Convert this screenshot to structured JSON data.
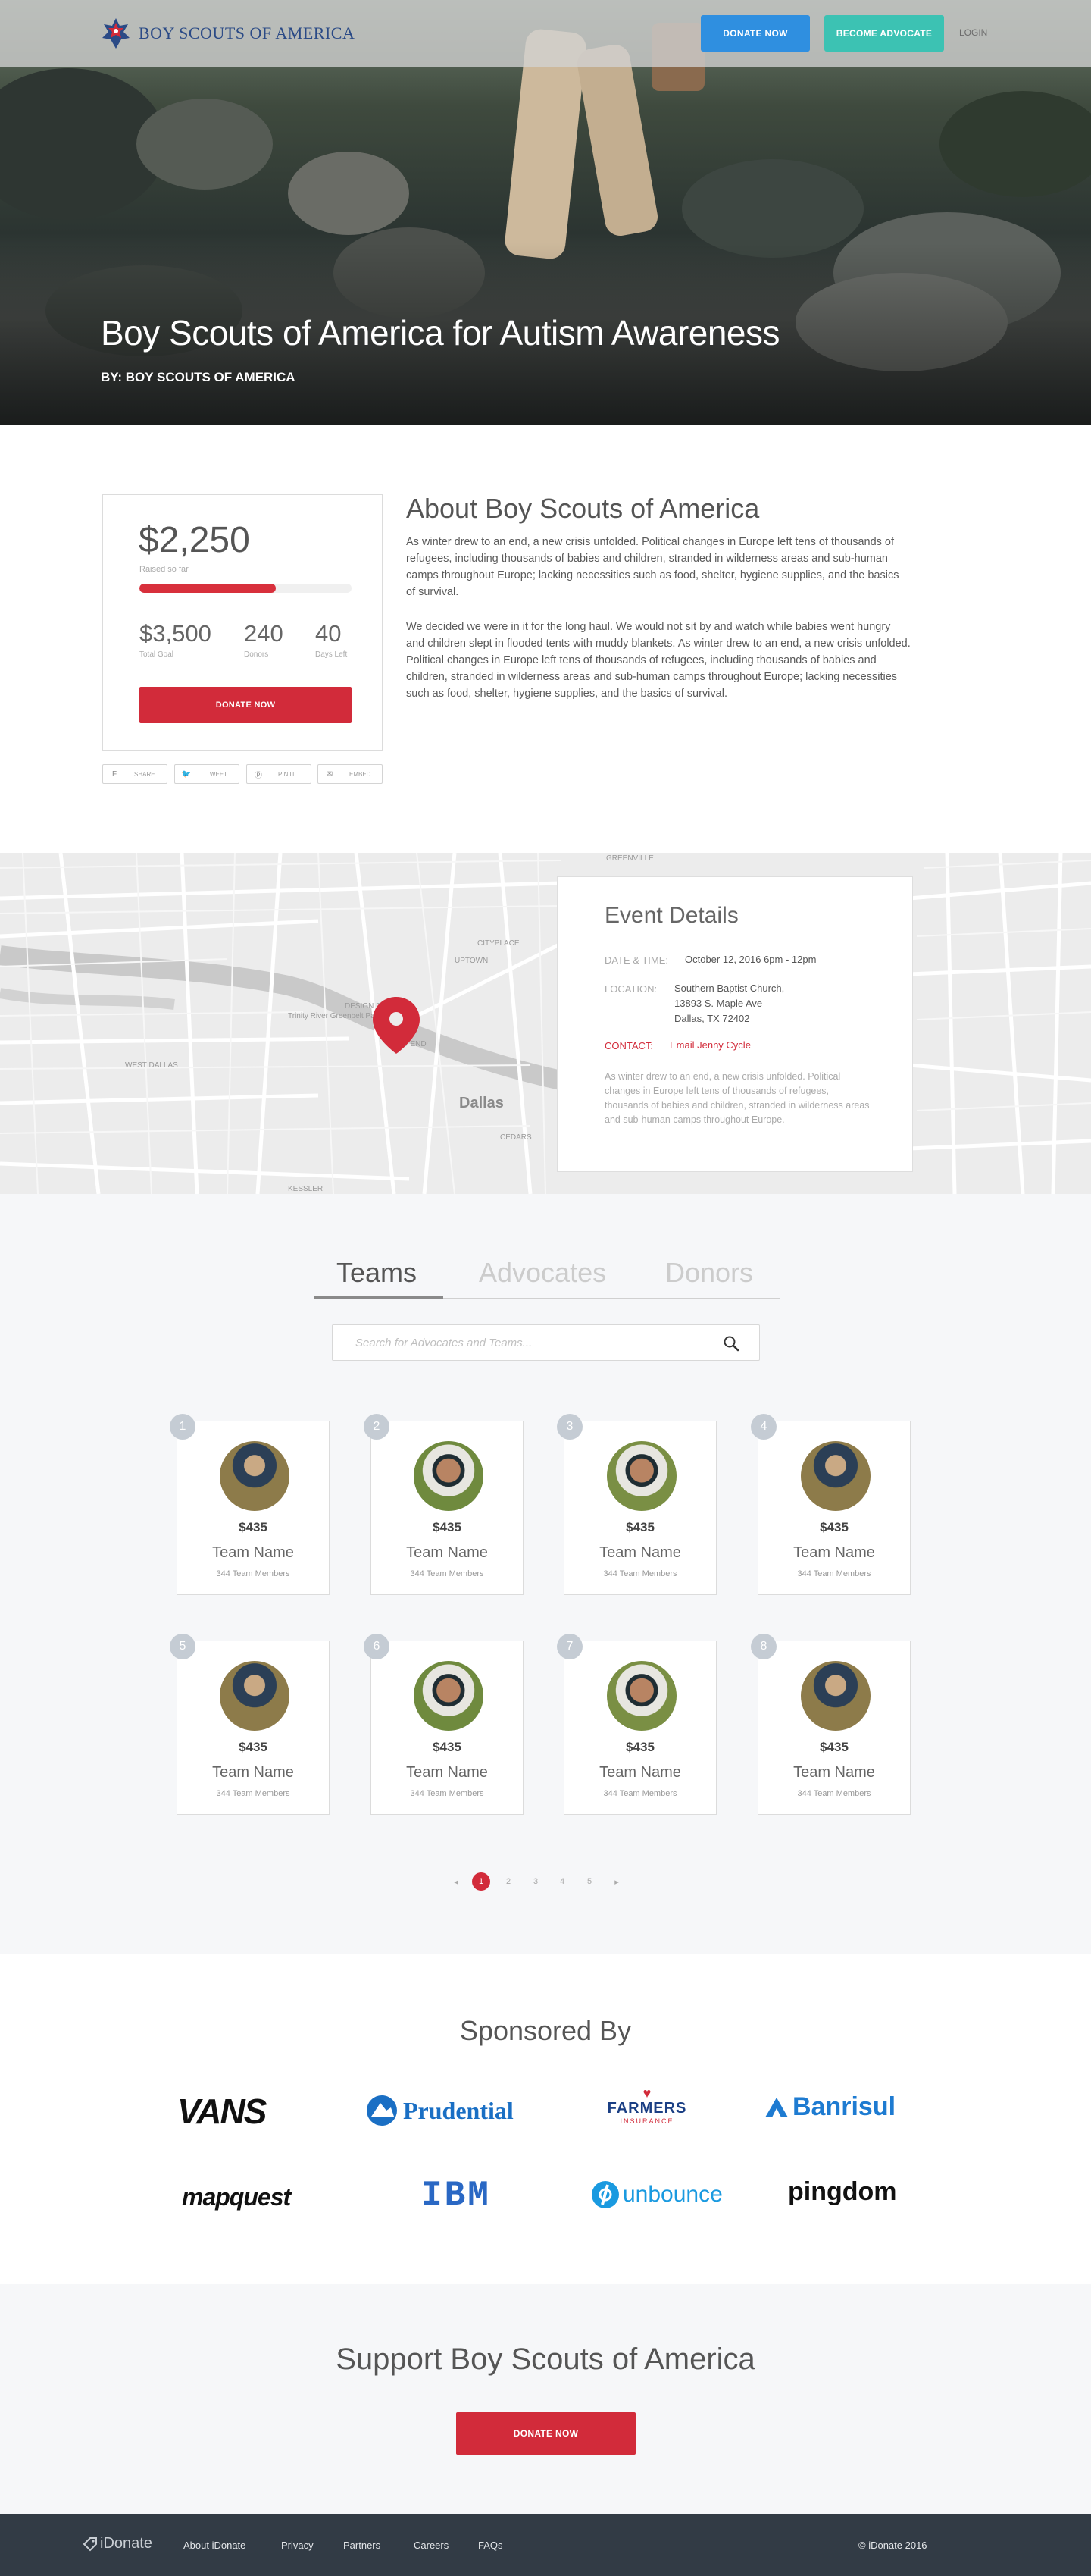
{
  "header": {
    "brand": "BOY SCOUTS OF AMERICA",
    "donate_label": "DONATE NOW",
    "advocate_label": "BECOME ADVOCATE",
    "login_label": "LOGIN"
  },
  "hero": {
    "title": "Boy Scouts of America for Autism Awareness",
    "byline": "BY: BOY SCOUTS OF AMERICA"
  },
  "campaign": {
    "raised": "$2,250",
    "raised_label": "Raised so far",
    "progress_fraction": 0.643,
    "goal": "$3,500",
    "goal_label": "Total Goal",
    "donors": "240",
    "donors_label": "Donors",
    "days": "40",
    "days_label": "Days Left",
    "donate_label": "DONATE NOW",
    "share": [
      "SHARE",
      "TWEET",
      "PIN IT",
      "EMBED"
    ]
  },
  "about": {
    "title": "About Boy Scouts of America",
    "p1": "As winter drew to an end, a new crisis unfolded. Political changes in Europe left tens of thousands of refugees, including thousands of babies and children, stranded in wilderness areas and sub-human camps throughout Europe; lacking necessities such as food, shelter, hygiene supplies, and the basics of survival.",
    "p2": "We decided we were in it for the long haul. We would not sit by and watch while babies went hungry and children slept in flooded tents with muddy blankets. As winter drew to an end, a new crisis unfolded. Political changes in Europe left tens of thousands of refugees, including thousands of babies and children, stranded in wilderness areas and sub-human camps throughout Europe; lacking necessities such as food, shelter, hygiene supplies, and the basics of survival."
  },
  "map": {
    "labels": [
      "Dallas",
      "WEST END",
      "UPTOWN",
      "CITYPLACE",
      "DESIGN DISTRICT",
      "WEST DALLAS",
      "Trinity River Greenbelt Park",
      "CEDARS",
      "GREENVILLE",
      "KESSLER"
    ]
  },
  "event": {
    "title": "Event Details",
    "date_label": "DATE & TIME:",
    "date": "October 12, 2016 6pm - 12pm",
    "location_label": "LOCATION:",
    "location_1": "Southern Baptist Church,",
    "location_2": "13893 S. Maple Ave",
    "location_3": "Dallas,  TX 72402",
    "contact_label": "CONTACT:",
    "contact": "Email Jenny Cycle",
    "description": "As winter drew to an end, a new crisis unfolded. Political changes in Europe left tens of thousands of refugees, thousands of babies and children, stranded in wilderness areas and sub-human camps throughout Europe."
  },
  "tabs": {
    "teams": "Teams",
    "advocates": "Advocates",
    "donors": "Donors"
  },
  "search": {
    "placeholder": "Search for Advocates and Teams..."
  },
  "teams": [
    {
      "rank": "1",
      "amount": "$435",
      "name": "Team Name",
      "members": "344 Team Members"
    },
    {
      "rank": "2",
      "amount": "$435",
      "name": "Team Name",
      "members": "344 Team Members"
    },
    {
      "rank": "3",
      "amount": "$435",
      "name": "Team Name",
      "members": "344 Team Members"
    },
    {
      "rank": "4",
      "amount": "$435",
      "name": "Team Name",
      "members": "344 Team Members"
    },
    {
      "rank": "5",
      "amount": "$435",
      "name": "Team Name",
      "members": "344 Team Members"
    },
    {
      "rank": "6",
      "amount": "$435",
      "name": "Team Name",
      "members": "344 Team Members"
    },
    {
      "rank": "7",
      "amount": "$435",
      "name": "Team Name",
      "members": "344 Team Members"
    },
    {
      "rank": "8",
      "amount": "$435",
      "name": "Team Name",
      "members": "344 Team Members"
    }
  ],
  "pagination": {
    "prev": "◂",
    "pages": [
      "1",
      "2",
      "3",
      "4",
      "5"
    ],
    "next": "▸"
  },
  "sponsors": {
    "title": "Sponsored By",
    "logos": [
      "VANS",
      "Prudential",
      "FARMERS",
      "INSURANCE",
      "Banrisul",
      "mapquest",
      "IBM",
      "unbounce",
      "pingdom"
    ]
  },
  "support": {
    "title": "Support Boy Scouts of America",
    "donate_label": "DONATE NOW"
  },
  "footer": {
    "brand": "iDonate",
    "links": [
      "About iDonate",
      "Privacy",
      "Partners",
      "Careers",
      "FAQs"
    ],
    "copyright": "© iDonate 2016"
  },
  "colors": {
    "accent_red": "#d22b3a",
    "blue": "#2f8fe0",
    "teal": "#3cc2b3",
    "footer": "#323b45"
  }
}
